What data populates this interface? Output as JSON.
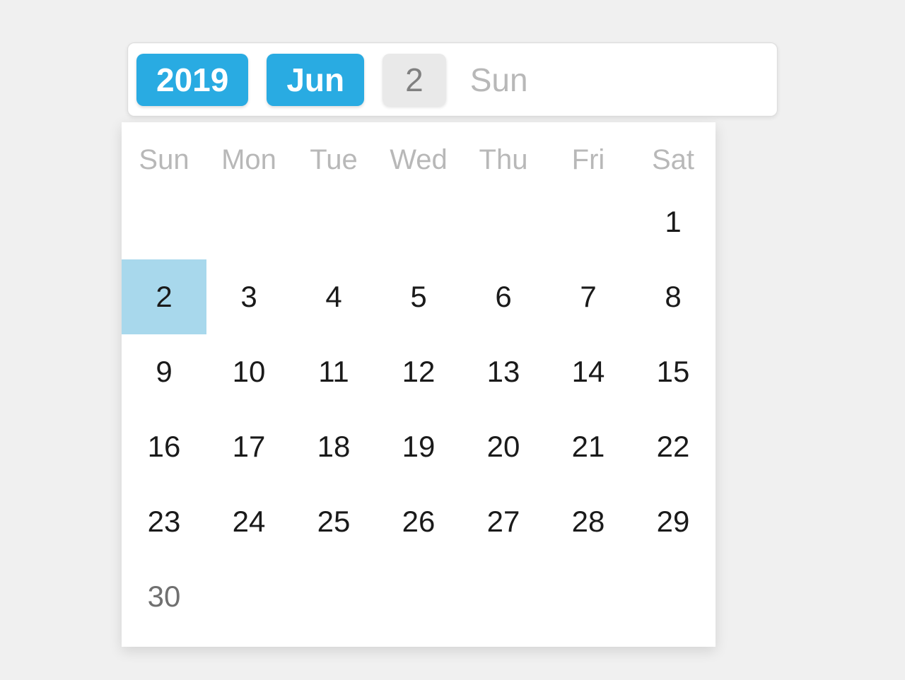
{
  "header": {
    "year": "2019",
    "month": "Jun",
    "day": "2",
    "weekday": "Sun"
  },
  "calendar": {
    "weekdays": [
      "Sun",
      "Mon",
      "Tue",
      "Wed",
      "Thu",
      "Fri",
      "Sat"
    ],
    "leading_blanks": 6,
    "days_in_month": 30,
    "selected_day": 2
  },
  "colors": {
    "accent": "#29abe2",
    "selected_bg": "#a8d8ec",
    "muted_text": "#b8b8b8"
  }
}
